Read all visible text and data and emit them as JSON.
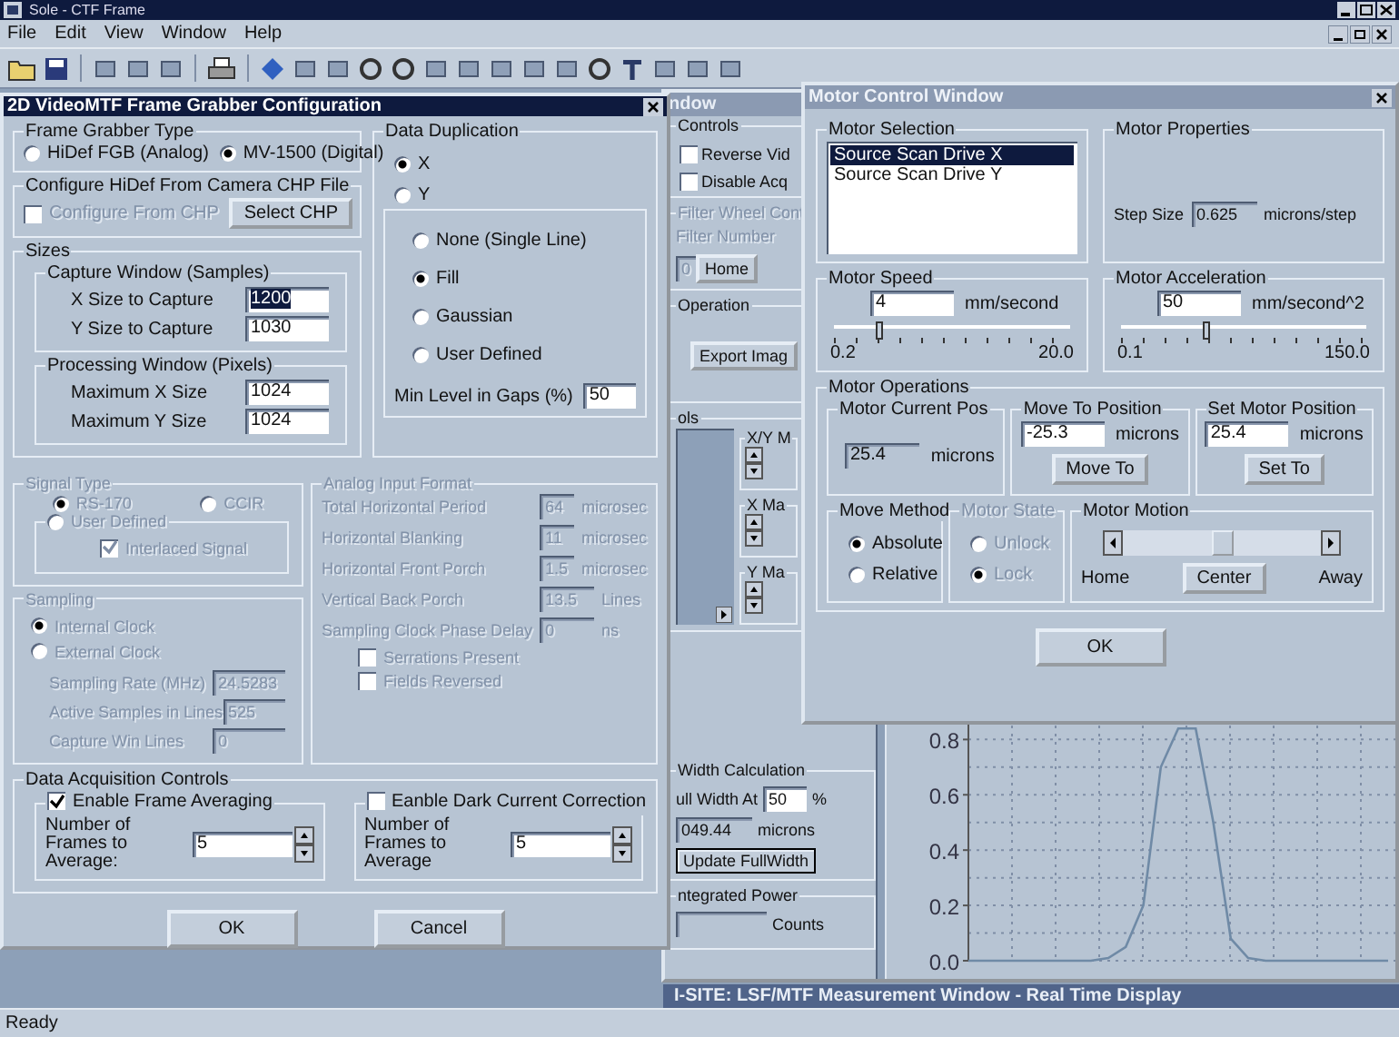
{
  "app": {
    "title": "Sole - CTF Frame"
  },
  "menu": [
    {
      "label": "File"
    },
    {
      "label": "Edit"
    },
    {
      "label": "View"
    },
    {
      "label": "Window"
    },
    {
      "label": "Help"
    }
  ],
  "frame_grabber": {
    "title": "2D VideoMTF Frame Grabber Configuration",
    "type": {
      "label": "Frame Grabber Type",
      "options": [
        {
          "label": "HiDef FGB (Analog)",
          "selected": false
        },
        {
          "label": "MV-1500 (Digital)",
          "selected": true
        }
      ]
    },
    "chp": {
      "label": "Configure HiDef From Camera CHP File",
      "disabled": true,
      "checkbox": {
        "label": "Configure From CHP",
        "checked": false
      },
      "button": "Select CHP"
    },
    "sizes": {
      "label": "Sizes",
      "groups": [
        {
          "label": "Capture Window (Samples)",
          "rows": [
            {
              "label": "X Size to Capture",
              "value": "1200",
              "selected": true
            },
            {
              "label": "Y Size to Capture",
              "value": "1030",
              "selected": false
            }
          ]
        },
        {
          "label": "Processing Window  (Pixels)",
          "rows": [
            {
              "label": "Maximum X Size",
              "value": "1024",
              "selected": false
            },
            {
              "label": "Maximum Y Size",
              "value": "1024",
              "selected": false
            }
          ]
        }
      ]
    },
    "duplication": {
      "label": "Data Duplication",
      "axes": [
        {
          "label": "X",
          "selected": true
        },
        {
          "label": "Y",
          "selected": false
        }
      ],
      "modes": [
        {
          "label": "None (Single Line)",
          "selected": false
        },
        {
          "label": "Fill",
          "selected": true
        },
        {
          "label": "Gaussian",
          "selected": false
        },
        {
          "label": "User Defined",
          "selected": false
        }
      ],
      "min_level": {
        "label": "Min Level in Gaps (%)",
        "value": "50"
      }
    },
    "signal": {
      "label": "Signal Type",
      "disabled": true,
      "options": [
        {
          "label": "RS-170",
          "selected": true
        },
        {
          "label": "CCIR",
          "selected": false
        }
      ],
      "user": {
        "label": "User Defined",
        "selected": false
      },
      "interlaced": {
        "label": "Interlaced Signal",
        "checked": true
      }
    },
    "sampling": {
      "label": "Sampling",
      "disabled": true,
      "options": [
        {
          "label": "Internal Clock",
          "selected": true
        },
        {
          "label": "External Clock",
          "selected": false
        }
      ],
      "rows": [
        {
          "label": "Sampling Rate (MHz)",
          "value": "24.5283"
        },
        {
          "label": "Active Samples in Lines",
          "value": "525"
        },
        {
          "label": "Capture Win Lines",
          "value": "0"
        }
      ]
    },
    "analog": {
      "label": "Analog Input Format",
      "disabled": true,
      "rows": [
        {
          "label": "Total Horizontal Period",
          "value": "64",
          "unit": "microsec"
        },
        {
          "label": "Horizontal Blanking",
          "value": "11",
          "unit": "microsec"
        },
        {
          "label": "Horizontal Front Porch",
          "value": "1.5",
          "unit": "microsec"
        },
        {
          "label": "Vertical Back Porch",
          "value": "13.5",
          "unit": "Lines"
        },
        {
          "label": "Sampling Clock Phase Delay",
          "value": "0",
          "unit": "ns"
        }
      ],
      "checks": [
        {
          "label": "Serrations Present",
          "checked": false
        },
        {
          "label": "Fields Reversed",
          "checked": false
        }
      ]
    },
    "acquisition": {
      "label": "Data Acquisition Controls",
      "groups": [
        {
          "label": "Enable Frame Averaging",
          "checked": true,
          "field_label": "Number of Frames to Average:",
          "value": "5"
        },
        {
          "label": "Eanble Dark Current Correction",
          "checked": false,
          "field_label": "Number of Frames to Average",
          "value": "5"
        }
      ]
    },
    "buttons": [
      {
        "label": "OK"
      },
      {
        "label": "Cancel"
      }
    ]
  },
  "measurement": {
    "title": "ndow",
    "controls": {
      "label": "Controls",
      "checks": [
        {
          "label": "Reverse Vid",
          "checked": false
        },
        {
          "label": "Disable Acq",
          "checked": false
        }
      ]
    },
    "filter": {
      "label": "Filter Wheel Cont",
      "disabled": true,
      "field_label": "Filter Number",
      "value": "0",
      "button": "Home"
    },
    "operation": {
      "label": "Operation",
      "button": "Export Imag"
    },
    "tools": {
      "label": "ols",
      "spinners": [
        {
          "label": "X/Y M"
        },
        {
          "label": "X Ma"
        },
        {
          "label": "Y Ma"
        }
      ]
    },
    "width_calc": {
      "label": "Width Calculation",
      "field_label": "ull Width At",
      "value": "50",
      "unit": "%",
      "result": "049.44",
      "result_unit": "microns",
      "button": "Update FullWidth"
    },
    "power": {
      "label": "ntegrated Power",
      "unit": "Counts"
    },
    "chart_data": {
      "type": "line",
      "grid": true,
      "ylim": [
        0,
        0.88
      ],
      "yticks": [
        {
          "value": 0,
          "label": "0.0"
        },
        {
          "value": 0.2,
          "label": "0.2"
        },
        {
          "value": 0.4,
          "label": "0.4"
        },
        {
          "value": 0.6,
          "label": "0.6"
        },
        {
          "value": 0.8,
          "label": "0.8"
        }
      ],
      "series": [
        {
          "color": "#6f8aa6",
          "values": [
            0,
            0,
            0,
            0,
            0,
            0,
            0,
            0,
            0.01,
            0.05,
            0.2,
            0.7,
            0.84,
            0.84,
            0.5,
            0.08,
            0.01,
            0,
            0,
            0,
            0,
            0,
            0,
            0,
            0
          ]
        }
      ]
    }
  },
  "motor": {
    "title": "Motor Control Window",
    "selection": {
      "label": "Motor Selection",
      "items": [
        {
          "label": "Source Scan Drive X",
          "selected": true
        },
        {
          "label": "Source Scan Drive Y",
          "selected": false
        }
      ]
    },
    "properties": {
      "label": "Motor Properties",
      "field_label": "Step Size",
      "value": "0.625",
      "unit": "microns/step"
    },
    "speed": {
      "label": "Motor Speed",
      "value": "4",
      "unit": "mm/second",
      "level": 0.18,
      "min": "0.2",
      "max": "20.0"
    },
    "acceleration": {
      "label": "Motor Acceleration",
      "value": "50",
      "unit": "mm/second^2",
      "level": 0.33,
      "min": "0.1",
      "max": "150.0"
    },
    "operations": {
      "label": "Motor Operations",
      "current": {
        "label": "Motor Current Pos",
        "value": "25.4",
        "unit": "microns"
      },
      "move_to": {
        "label": "Move To Position",
        "value": "-25.3",
        "unit": "microns",
        "button": "Move To"
      },
      "set_pos": {
        "label": "Set Motor Position",
        "value": "25.4",
        "unit": "microns",
        "button": "Set To"
      },
      "method": {
        "label": "Move Method",
        "options": [
          {
            "label": "Absolute",
            "selected": true
          },
          {
            "label": "Relative",
            "selected": false
          }
        ]
      },
      "state": {
        "label": "Motor State",
        "disabled": true,
        "options": [
          {
            "label": "Unlock",
            "selected": false
          },
          {
            "label": "Lock",
            "selected": true
          }
        ]
      },
      "motion": {
        "label": "Motor Motion",
        "level": 0.5,
        "home": "Home",
        "away": "Away",
        "button": "Center"
      }
    },
    "button": "OK"
  },
  "status_bar": {
    "text": "Ready",
    "window_title": "I-SITE:  LSF/MTF Measurement Window - Real Time Display"
  }
}
